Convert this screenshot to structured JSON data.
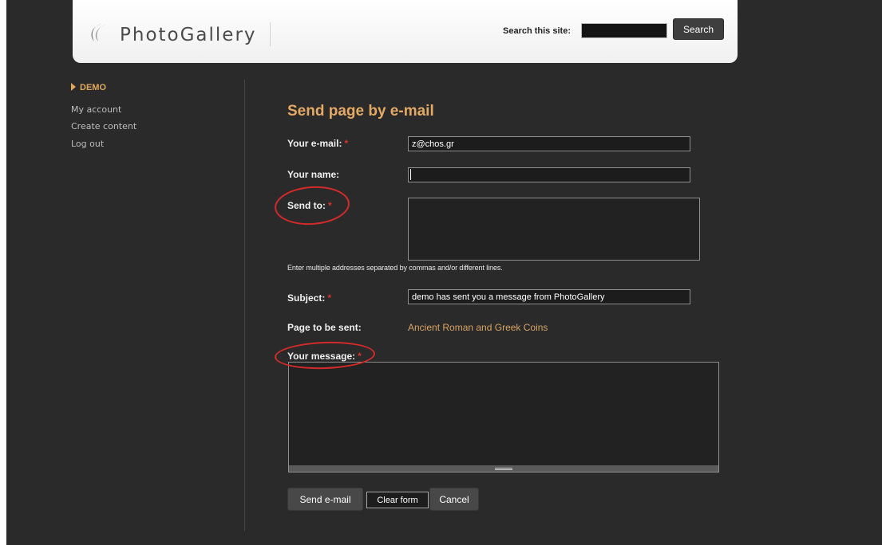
{
  "header": {
    "logo_text": "PhotoGallery",
    "search_label": "Search this site:",
    "search_value": "",
    "search_button": "Search"
  },
  "sidebar": {
    "user": "DEMO",
    "links": [
      "My account",
      "Create content",
      "Log out"
    ]
  },
  "form": {
    "title": "Send page by e-mail",
    "your_email_label": "Your e-mail:",
    "your_email_value": "z@chos.gr",
    "your_name_label": "Your name:",
    "your_name_value": "",
    "send_to_label": "Send to:",
    "send_to_value": "",
    "send_to_help": "Enter multiple addresses separated by commas and/or different lines.",
    "subject_label": "Subject:",
    "subject_value": "demo has sent you a message from PhotoGallery",
    "page_label": "Page to be sent:",
    "page_value": "Ancient Roman and Greek Coins",
    "message_label": "Your message:",
    "message_value": "",
    "required_marker": "*"
  },
  "buttons": {
    "send": "Send e-mail",
    "clear": "Clear form",
    "cancel": "Cancel"
  },
  "colors": {
    "background": "#2a2a2a",
    "accent": "#e3a965",
    "link": "#d7a365",
    "required": "#d9332b",
    "annotation_ring": "#d42a2a"
  },
  "icons": {
    "logo": "crescent-logo-icon",
    "user_marker": "triangle-right-icon",
    "resize": "grippie-handle-icon"
  }
}
